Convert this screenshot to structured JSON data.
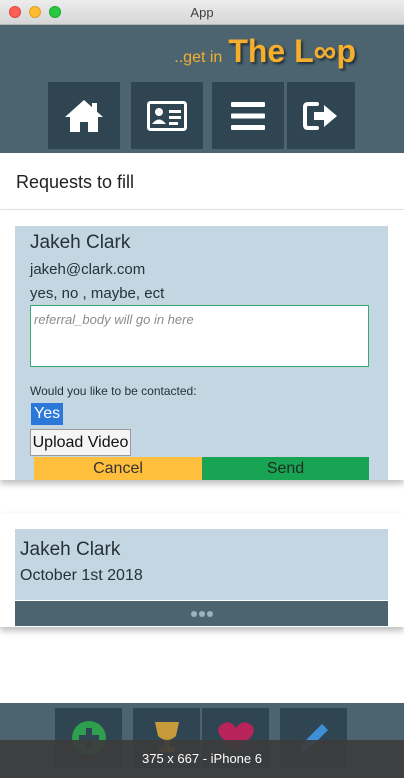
{
  "window": {
    "title": "App"
  },
  "header": {
    "brand_prefix": "..get in",
    "brand_name": "The L∞p",
    "nav": [
      {
        "icon": "home-icon"
      },
      {
        "icon": "contact-card-icon"
      },
      {
        "icon": "menu-icon"
      },
      {
        "icon": "sign-out-icon"
      }
    ]
  },
  "page": {
    "section_title": "Requests to fill"
  },
  "request_card": {
    "name": "Jakeh Clark",
    "email": "jakeh@clark.com",
    "answers": "yes, no , maybe, ect",
    "referral_placeholder": "referral_body will go in here",
    "referral_value": "",
    "contact_question": "Would you like to be contacted:",
    "contact_selected": "Yes",
    "upload_label": "Upload Video",
    "cancel_label": "Cancel",
    "send_label": "Send"
  },
  "second_card": {
    "name": "Jakeh Clark",
    "date": "October 1st 2018"
  },
  "colors": {
    "header": "#4b6470",
    "nav_button": "#2f4652",
    "accent": "#f6ae2d",
    "card": "#c3d6e1",
    "cancel": "#ffbe3b",
    "send": "#18a452"
  },
  "footer": {
    "buttons": [
      {
        "icon": "plus-circle-icon"
      },
      {
        "icon": "trophy-icon"
      },
      {
        "icon": "heart-icon"
      },
      {
        "icon": "pencil-icon"
      }
    ]
  },
  "device_label": "375 x 667 - iPhone 6"
}
